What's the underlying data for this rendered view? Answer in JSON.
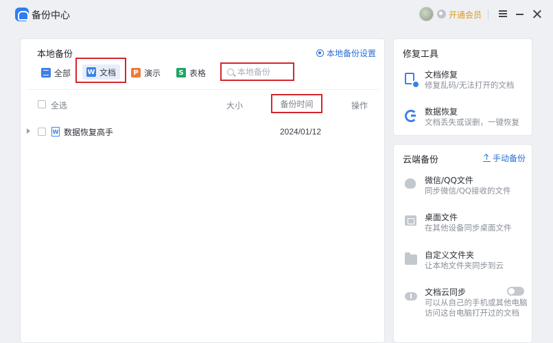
{
  "app": {
    "title": "备份中心",
    "vip_label": "开通会员"
  },
  "local_backup": {
    "title": "本地备份",
    "settings_label": "本地备份设置",
    "filters": [
      {
        "label": "全部",
        "icon": "list-icon"
      },
      {
        "label": "文档",
        "icon": "W"
      },
      {
        "label": "演示",
        "icon": "P"
      },
      {
        "label": "表格",
        "icon": "S"
      }
    ],
    "search_placeholder": "本地备份",
    "columns": {
      "select_all": "全选",
      "size": "大小",
      "time": "备份时间",
      "action": "操作"
    },
    "rows": [
      {
        "name": "数据恢复高手",
        "icon": "W",
        "size": "",
        "time": "2024/01/12"
      }
    ]
  },
  "repair_tools": {
    "title": "修复工具",
    "items": [
      {
        "name": "文档修复",
        "desc": "修复乱码/无法打开的文档"
      },
      {
        "name": "数据恢复",
        "desc": "文档丢失或误删，一键恢复"
      }
    ]
  },
  "cloud_backup": {
    "title": "云端备份",
    "manual_label": "手动备份",
    "items": [
      {
        "name": "微信/QQ文件",
        "desc": "同步微信/QQ接收的文件"
      },
      {
        "name": "桌面文件",
        "desc": "在其他设备同步桌面文件"
      },
      {
        "name": "自定义文件夹",
        "desc": "让本地文件夹同步到云"
      },
      {
        "name": "文档云同步",
        "desc": "可以从自己的手机或其他电脑",
        "desc2": "访问这台电脑打开过的文档"
      }
    ]
  },
  "colors": {
    "accent": "#2a6fd6",
    "highlight": "#d4242b",
    "vip": "#e09a25"
  }
}
